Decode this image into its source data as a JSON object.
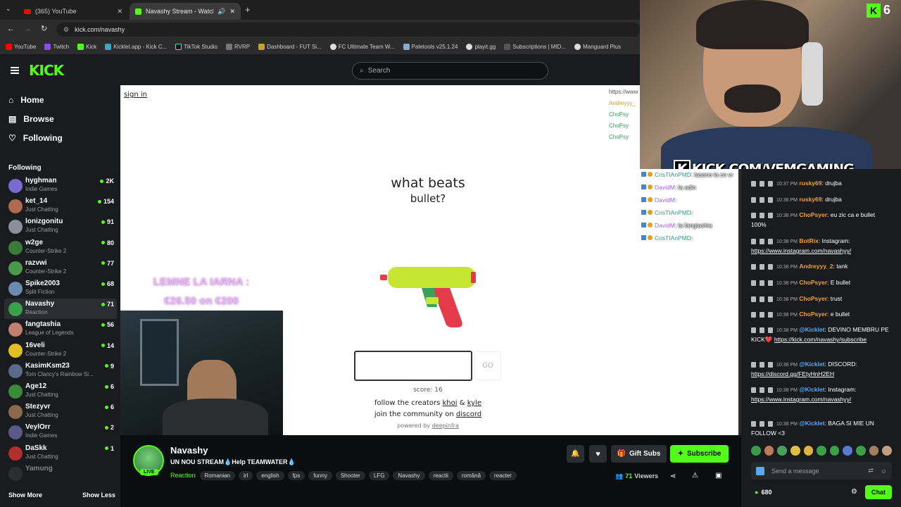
{
  "browser": {
    "tabs": [
      {
        "label": "(365) YouTube"
      },
      {
        "label": "Navashy Stream - Watch Li"
      }
    ],
    "url": "kick.com/navashy",
    "bookmarks": [
      "YouTube",
      "Twitch",
      "Kick",
      "Kicklet.app - Kick C...",
      "TikTok Studio",
      "RVRP",
      "Dashboard - FUT Si...",
      "FC Ultimate Team W...",
      "Paletools v25.1.24",
      "playit.gg",
      "Subscriptions | MID...",
      "Manguard Plus"
    ]
  },
  "header": {
    "logo": "KICK",
    "search_placeholder": "Search"
  },
  "sidebar": {
    "nav": [
      {
        "label": "Home"
      },
      {
        "label": "Browse"
      },
      {
        "label": "Following"
      }
    ],
    "section_title": "Following",
    "channels": [
      {
        "name": "hyghman",
        "category": "Indie Games",
        "viewers": "2K",
        "color": "#7a6ad0"
      },
      {
        "name": "ket_14",
        "category": "Just Chatting",
        "viewers": "154",
        "color": "#b06a50"
      },
      {
        "name": "lonizgonitu",
        "category": "Just Chatting",
        "viewers": "91",
        "color": "#8a8f99"
      },
      {
        "name": "w2ge",
        "category": "Counter-Strike 2",
        "viewers": "80",
        "color": "#3a7a3a"
      },
      {
        "name": "razvwi",
        "category": "Counter-Strike 2",
        "viewers": "77",
        "color": "#4a9a4a"
      },
      {
        "name": "Spike2003",
        "category": "Split Fiction",
        "viewers": "68",
        "color": "#6a8ab0"
      },
      {
        "name": "Navashy",
        "category": "Reaction",
        "viewers": "71",
        "color": "#3aa04a"
      },
      {
        "name": "fangtashia",
        "category": "League of Legends",
        "viewers": "56",
        "color": "#c08070"
      },
      {
        "name": "16veli",
        "category": "Counter-Strike 2",
        "viewers": "14",
        "color": "#e0c020"
      },
      {
        "name": "KasimKsm23",
        "category": "Tom Clancy's Rainbow Si...",
        "viewers": "9",
        "color": "#5a6a8a"
      },
      {
        "name": "Age12",
        "category": "Just Chatting",
        "viewers": "6",
        "color": "#3a8a3a"
      },
      {
        "name": "Stezyvr",
        "category": "Just Chatting",
        "viewers": "6",
        "color": "#8a6a4a"
      },
      {
        "name": "VeylOrr",
        "category": "Indie Games",
        "viewers": "2",
        "color": "#5a5a8a"
      },
      {
        "name": "DaSkk",
        "category": "Just Chatting",
        "viewers": "1",
        "color": "#b03030"
      },
      {
        "name": "Yamung",
        "category": "",
        "viewers": "",
        "color": "#444"
      }
    ],
    "show_more": "Show More",
    "show_less": "Show Less"
  },
  "game": {
    "sign_in": "sign in",
    "question_line1": "what beats",
    "question_line2": "bullet?",
    "go_label": "GO",
    "score": "score: 16",
    "follow_prefix": "follow the creators",
    "creator1": "khoi",
    "amp": "&",
    "creator2": "kyle",
    "join_prefix": "join the community on",
    "discord": "discord",
    "powered": "powered by",
    "deepinfra": "deepinfra"
  },
  "overlay": {
    "goal_line1": "LEMNE LA IARNA :",
    "goal_line2": "€26.50 on €200",
    "brand": "KICK.COM/VFMGAMING",
    "cam_badge": "6",
    "small_chat": [
      {
        "user": "CrisTIAnPMD",
        "text": ": lasane la cn vr"
      },
      {
        "user": "DavidM",
        "text": ": la adin"
      },
      {
        "user": "DavidM",
        "text": ":"
      },
      {
        "user": "CrisTIAnPMD",
        "text": ":"
      },
      {
        "user": "DavidM",
        "text": ": la fangtashia"
      },
      {
        "user": "CrisTIAnPMD",
        "text": ":"
      }
    ],
    "top_right": [
      "https://www",
      "Andreyyy_",
      "ChoPsy",
      "ChoPsy",
      "ChoPsy"
    ]
  },
  "stream_info": {
    "streamer": "Navashy",
    "live_badge": "LIVE",
    "title": "UN NOU STREAM💧Help TEAMWATER💧",
    "category": "Reaction",
    "tags": [
      "Romanian",
      "irl",
      "english",
      "fps",
      "funny",
      "Shooter",
      "LFG",
      "Navashy",
      "reactii",
      "română",
      "reacter"
    ],
    "gift_subs": "Gift Subs",
    "subscribe": "Subscribe",
    "viewers": "71",
    "viewers_label": "Viewers"
  },
  "chat": {
    "messages": [
      {
        "time": "10:37 PM",
        "user": "rusky69",
        "user_color": "#f0a030",
        "text": ": drujba"
      },
      {
        "time": "10:38 PM",
        "user": "rusky69",
        "user_color": "#f0a030",
        "text": ": drujba"
      },
      {
        "time": "10:38 PM",
        "user": "ChoPsyer",
        "user_color": "#f0a030",
        "text": ": eu zic ca e bullet 100%"
      },
      {
        "time": "10:38 PM",
        "user": "BotRix",
        "user_color": "#f0a030",
        "text": ": Instagram:",
        "link": "https://www.instagram.com/navashyy/"
      },
      {
        "time": "10:38 PM",
        "user": "Andreyyy_2",
        "user_color": "#f0a030",
        "text": ": tank"
      },
      {
        "time": "10:38 PM",
        "user": "ChoPsyer",
        "user_color": "#f0a030",
        "text": ": E bullet"
      },
      {
        "time": "10:38 PM",
        "user": "ChoPsyer",
        "user_color": "#f0a030",
        "text": ": trust"
      },
      {
        "time": "10:38 PM",
        "user": "ChoPsyer",
        "user_color": "#f0a030",
        "text": ": e bullet"
      },
      {
        "time": "10:38 PM",
        "user": "@Kicklet",
        "user_color": "#5aa8f0",
        "text": ": DEVINO MEMBRU PE KICK❤️",
        "link": "https://kick.com/navashy/subscribe"
      },
      {
        "time": "10:38 PM",
        "user": "@Kicklet",
        "user_color": "#5aa8f0",
        "text": ": DISCORD:",
        "link": "https://discord.gg/FEtyHnH2EH"
      },
      {
        "time": "10:38 PM",
        "user": "@Kicklet",
        "user_color": "#5aa8f0",
        "text": ": Instagram:",
        "link": "https://www.instagram.com/navashyy/"
      },
      {
        "time": "10:38 PM",
        "user": "@Kicklet",
        "user_color": "#5aa8f0",
        "text": ": BAGA SI MIE UN FOLLOW <3"
      }
    ],
    "input_placeholder": "Send a message",
    "points": "680",
    "chat_button": "Chat"
  },
  "colors": {
    "kick_green": "#53fc18",
    "bg_dark": "#0b0e0f",
    "panel": "#191b1f"
  }
}
